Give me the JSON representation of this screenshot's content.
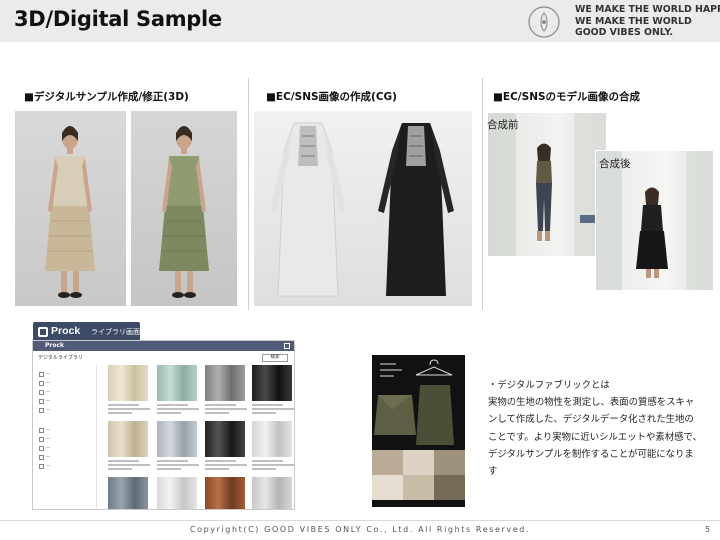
{
  "header": {
    "title": "3D/Digital Sample",
    "logo_text": "GOOD VIBES ONLY",
    "tagline": [
      "WE MAKE THE WORLD HAPPY.",
      "WE MAKE THE WORLD",
      "GOOD VIBES ONLY."
    ]
  },
  "sections": [
    {
      "label": "■デジタルサンプル作成/修正(3D)"
    },
    {
      "label": "■EC/SNS画像の作成(CG)"
    },
    {
      "label": "■EC/SNSのモデル画像の合成"
    }
  ],
  "composite": {
    "before_label": "合成前",
    "after_label": "合成後",
    "arrow_icon": "arrow-right-icon"
  },
  "library": {
    "brand": "Prock",
    "tab_label": "ライブラリ画面",
    "window_title": "Prock",
    "heading": "デジタルライブラリ",
    "button": "検索"
  },
  "description": {
    "lines": [
      "・デジタルファブリックとは",
      "実物の生地の物性を測定し、表面の質感をスキャ",
      "ンして作成した、デジタルデータ化された生地の",
      "ことです。より実物に近いシルエットや素材感で、",
      "デジタルサンプルを制作することが可能になりま",
      "す"
    ]
  },
  "footer": {
    "copyright": "Copyright(C)  GOOD VIBES ONLY Co., Ltd. All Rights Reserved.",
    "page": "5"
  },
  "colors": {
    "header_bg": "#ebebeb",
    "library_accent": "#3d4a66",
    "arrow": "#5a6b86"
  }
}
